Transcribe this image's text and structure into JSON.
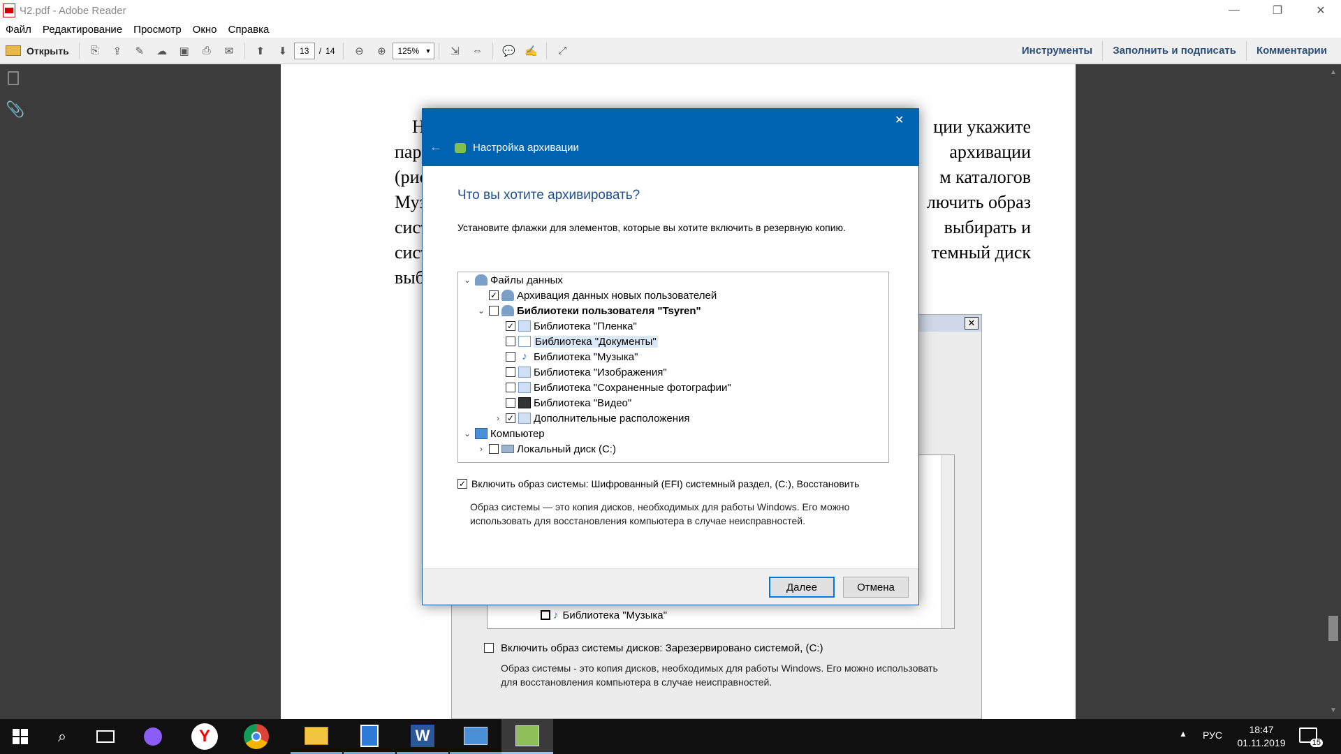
{
  "window": {
    "title": "Ч2.pdf - Adobe Reader",
    "minimize": "—",
    "restore": "❐",
    "close": "✕"
  },
  "menu": [
    "Файл",
    "Редактирование",
    "Просмотр",
    "Окно",
    "Справка"
  ],
  "toolbar": {
    "open_label": "Открыть",
    "page_current": "13",
    "page_sep": "/",
    "page_total": "14",
    "zoom": "125%",
    "right_links": [
      "Инструменты",
      "Заполнить и подписать",
      "Комментарии"
    ]
  },
  "document": {
    "lines": [
      {
        "left": "Н",
        "right": "ции укажите"
      },
      {
        "left": "пар",
        "right": "архивации"
      },
      {
        "left": "(рис",
        "right": "м каталогов"
      },
      {
        "left": "Муз",
        "right": "лючить образ"
      },
      {
        "left": "сист",
        "right": "выбирать и"
      },
      {
        "left": "сист",
        "right": "темный диск"
      },
      {
        "left": "выб",
        "right": ""
      }
    ]
  },
  "old_dialog": {
    "close": "✕",
    "music_item": "Библиотека \"Музыка\"",
    "system_image_label": "Включить образ системы дисков: Зарезервировано системой, (C:)",
    "desc_line1": "Образ системы - это копия дисков, необходимых для работы Windows. Его можно использовать",
    "desc_line2": "для восстановления компьютера в случае неисправностей."
  },
  "dialog": {
    "close": "✕",
    "back": "←",
    "title": "Настройка архивации",
    "heading": "Что вы хотите архивировать?",
    "instruction": "Установите флажки для элементов, которые вы хотите включить в резервную копию.",
    "tree": [
      {
        "label": "Файлы данных",
        "checkbox": false,
        "checked": false,
        "bold": false,
        "expander": "⌄",
        "level": 0
      },
      {
        "label": "Архивация данных новых пользователей",
        "checkbox": true,
        "checked": true,
        "bold": false,
        "expander": "",
        "level": 1
      },
      {
        "label": "Библиотеки пользователя \"Tsyren\"",
        "checkbox": true,
        "checked": false,
        "bold": true,
        "expander": "⌄",
        "level": 1
      },
      {
        "label": "Библиотека \"Пленка\"",
        "checkbox": true,
        "checked": true,
        "bold": false,
        "expander": "",
        "level": 2
      },
      {
        "label": "Библиотека \"Документы\"",
        "checkbox": true,
        "checked": false,
        "bold": false,
        "expander": "",
        "level": 2,
        "selected": true
      },
      {
        "label": "Библиотека \"Музыка\"",
        "checkbox": true,
        "checked": false,
        "bold": false,
        "expander": "",
        "level": 2
      },
      {
        "label": "Библиотека \"Изображения\"",
        "checkbox": true,
        "checked": false,
        "bold": false,
        "expander": "",
        "level": 2
      },
      {
        "label": "Библиотека \"Сохраненные фотографии\"",
        "checkbox": true,
        "checked": false,
        "bold": false,
        "expander": "",
        "level": 2
      },
      {
        "label": "Библиотека \"Видео\"",
        "checkbox": true,
        "checked": false,
        "bold": false,
        "expander": "",
        "level": 2
      },
      {
        "label": "Дополнительные расположения",
        "checkbox": true,
        "checked": true,
        "bold": false,
        "expander": "›",
        "level": 2
      },
      {
        "label": "Компьютер",
        "checkbox": false,
        "checked": false,
        "bold": false,
        "expander": "⌄",
        "level": 0
      },
      {
        "label": "Локальный диск (C:)",
        "checkbox": true,
        "checked": false,
        "bold": false,
        "expander": "›",
        "level": 1
      }
    ],
    "system_image_checked": true,
    "system_image_label": "Включить образ системы: Шифрованный (EFI) системный раздел, (C:), Восстановить",
    "desc_line1": "Образ системы — это копия дисков, необходимых для работы Windows. Его можно",
    "desc_line2": "использовать для восстановления компьютера в случае неисправностей.",
    "next_button": "Далее",
    "cancel_button": "Отмена"
  },
  "taskbar": {
    "language": "РУС",
    "time": "18:47",
    "date": "01.11.2019",
    "notifications": "15",
    "tray_arrow": "▲"
  },
  "colors": {
    "accent": "#0063b1",
    "heading": "#1e4e8c",
    "taskbar": "#101010"
  }
}
